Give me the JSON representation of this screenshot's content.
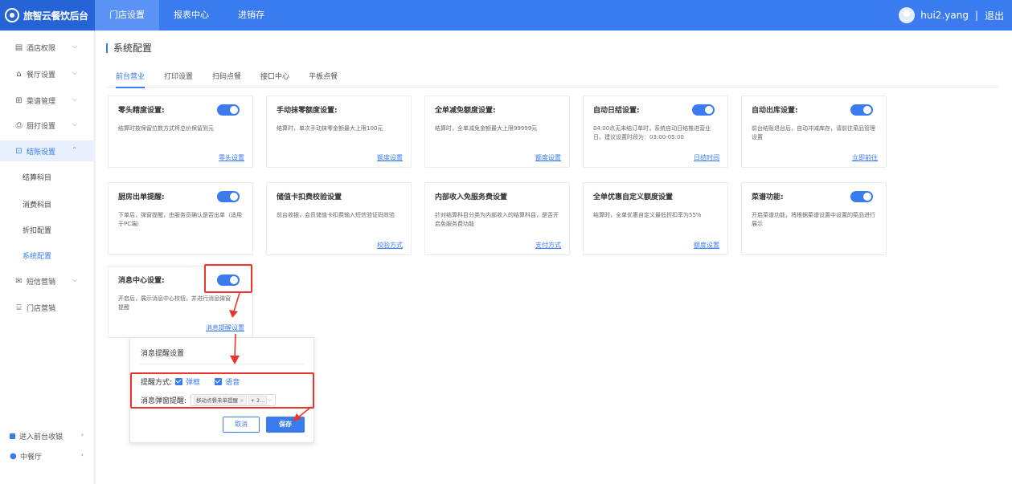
{
  "brand": {
    "name": "旅智云餐饮后台"
  },
  "topnav": [
    {
      "label": "门店设置"
    },
    {
      "label": "报表中心"
    },
    {
      "label": "进销存"
    }
  ],
  "user": {
    "name": "hui2.yang",
    "separator": "|",
    "logout": "退出"
  },
  "sidebar": {
    "items": [
      {
        "label": "酒店权限",
        "icon": "hotel-icon"
      },
      {
        "label": "餐厅设置",
        "icon": "home-icon"
      },
      {
        "label": "菜谱管理",
        "icon": "grid-icon"
      },
      {
        "label": "厨打设置",
        "icon": "printer-icon"
      },
      {
        "label": "结账设置",
        "icon": "checkout-icon"
      },
      {
        "label": "结算科目"
      },
      {
        "label": "消费科目"
      },
      {
        "label": "折扣配置"
      },
      {
        "label": "系统配置"
      },
      {
        "label": "短信营销",
        "icon": "mail-icon"
      },
      {
        "label": "门店营销",
        "icon": "store-icon"
      }
    ],
    "bottom": [
      {
        "label": "进入前台收银",
        "icon": "cashier-icon"
      },
      {
        "label": "中餐厅",
        "icon": "location-icon"
      }
    ]
  },
  "page": {
    "title": "系统配置",
    "tabs": [
      "前台营业",
      "打印设置",
      "扫码点餐",
      "接口中心",
      "平板点餐"
    ]
  },
  "cards": [
    {
      "title": "零头精度设置:",
      "desc": "结算时按保留位数方式将总价保留到元",
      "link": "零头设置",
      "toggle": true
    },
    {
      "title": "手动抹零额度设置:",
      "desc": "结算时，单次手动抹零金额最大上限100元",
      "link": "额度设置",
      "toggle": false
    },
    {
      "title": "全单减免额度设置:",
      "desc": "结算时，全单减免金额最大上限99999元",
      "link": "额度设置",
      "toggle": false
    },
    {
      "title": "自动日结设置:",
      "desc": "04:00点无未结订单时，系统自动日结推进营业日。建议设置时段为：03:00-05:00",
      "link": "日结时间",
      "toggle": true
    },
    {
      "title": "自动出库设置:",
      "desc": "前台结账退台后，自动冲减库存，请前往菜品管理设置",
      "link": "立即前往",
      "toggle": true
    },
    {
      "title": "厨房出单提醒:",
      "desc": "下单后，弹窗提醒，由服务员确认是否出单（适用于PC端）",
      "link": "",
      "toggle": true
    },
    {
      "title": "储值卡扣费校验设置",
      "desc": "前台收银，会员储值卡扣费输入短信验证码效验",
      "link": "校验方式",
      "toggle": false
    },
    {
      "title": "内部收入免服务费设置",
      "desc": "针对结算科目分类为内部收入的结算科目，是否开启免服务费功能",
      "link": "支付方式",
      "toggle": false
    },
    {
      "title": "全单优惠自定义额度设置",
      "desc": "结算时，全单优惠自定义最低折扣率为55%",
      "link": "额度设置",
      "toggle": false
    },
    {
      "title": "菜谱功能:",
      "desc": "开启菜谱功能，将根据菜谱设置中设置的菜品进行展示",
      "link": "",
      "toggle": true
    },
    {
      "title": "消息中心设置:",
      "desc": "开启后，展示消息中心校钮，并进行消息弹窗提醒",
      "link": "消息提醒设置",
      "toggle": true
    }
  ],
  "popover": {
    "title": "消息提醒设置",
    "mode_label": "提醒方式:",
    "options": [
      "弹框",
      "语音"
    ],
    "popup_label": "消息弹窗提醒:",
    "tag": "移动点餐未单提醒",
    "more": "+ 2...",
    "cancel": "取消",
    "save": "保存"
  },
  "colors": {
    "primary": "#3a7bf0",
    "annotation": "#e8362c"
  }
}
